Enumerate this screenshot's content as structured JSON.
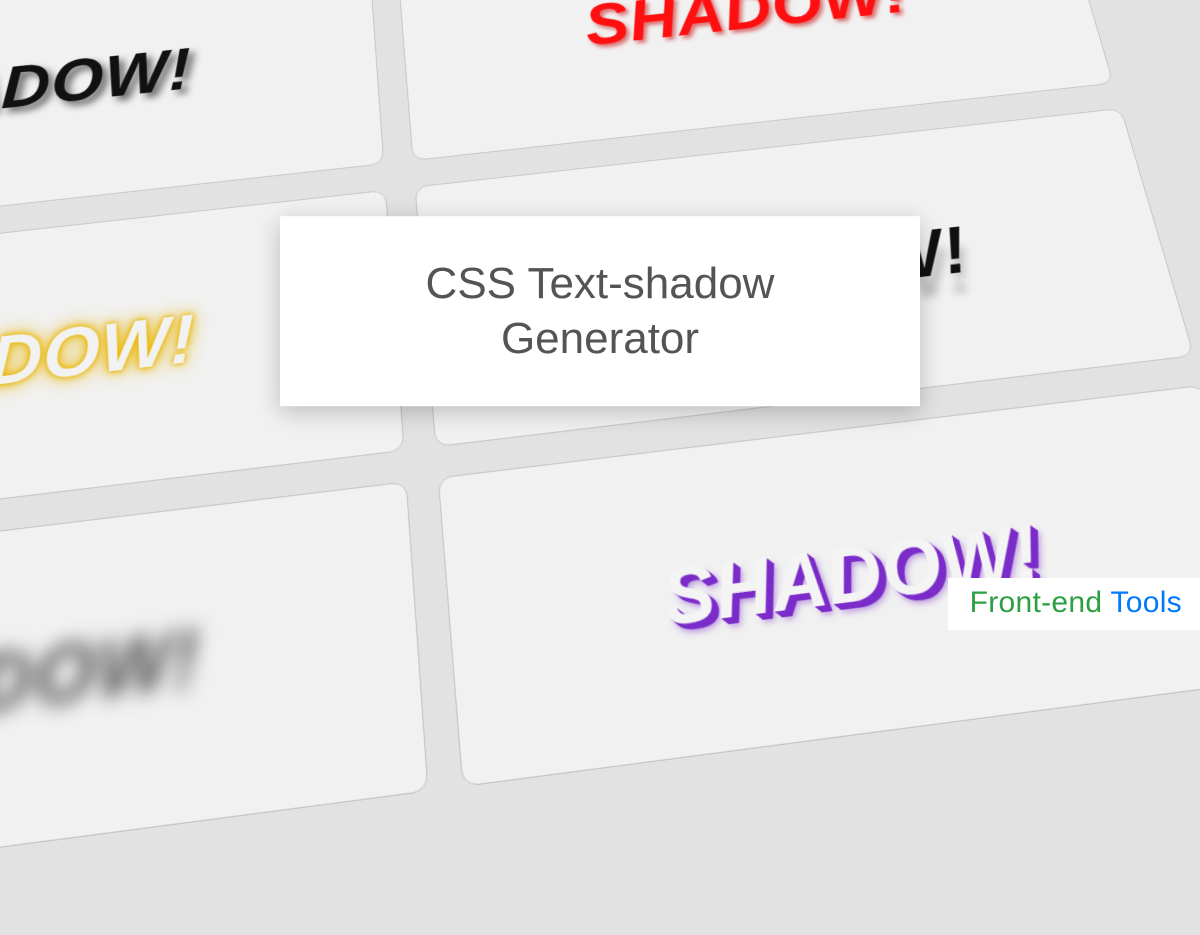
{
  "title": {
    "line1": "CSS Text-shadow",
    "line2": "Generator"
  },
  "brand": {
    "part1": "Front-end",
    "part2": " Tools"
  },
  "samples": {
    "black_drop": "SHADOW!",
    "red": "SHADOW!",
    "yellow_glow": "SHADOW!",
    "reflect": "SHADOW!",
    "blur": "SHADOW!",
    "purple": "SHADOW!"
  }
}
